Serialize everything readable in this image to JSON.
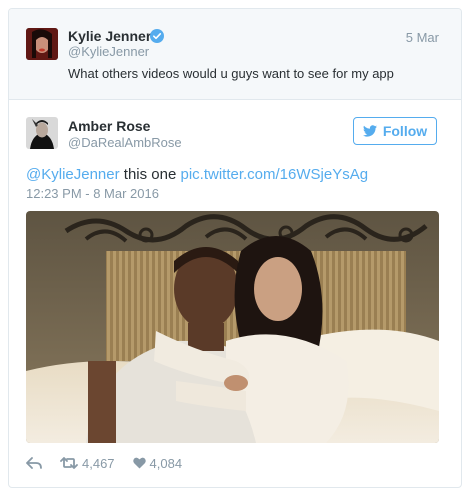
{
  "context_tweet": {
    "name": "Kylie Jenner",
    "handle": "@KylieJenner",
    "date": "5 Mar",
    "text": "What others videos would u guys want to see for my app",
    "verified_icon": "verified-badge-icon"
  },
  "tweet": {
    "name": "Amber Rose",
    "handle": "@DaRealAmbRose",
    "follow_label": "Follow",
    "mention": "@KylieJenner",
    "text_middle": " this one ",
    "pic_link": "pic.twitter.com/16WSjeYsAg",
    "timestamp": "12:23 PM - 8 Mar 2016",
    "retweets": "4,467",
    "likes": "4,084"
  },
  "colors": {
    "accent": "#55acee",
    "muted": "#8899a6",
    "text": "#292f33",
    "context_bg": "#f5f8fa"
  }
}
